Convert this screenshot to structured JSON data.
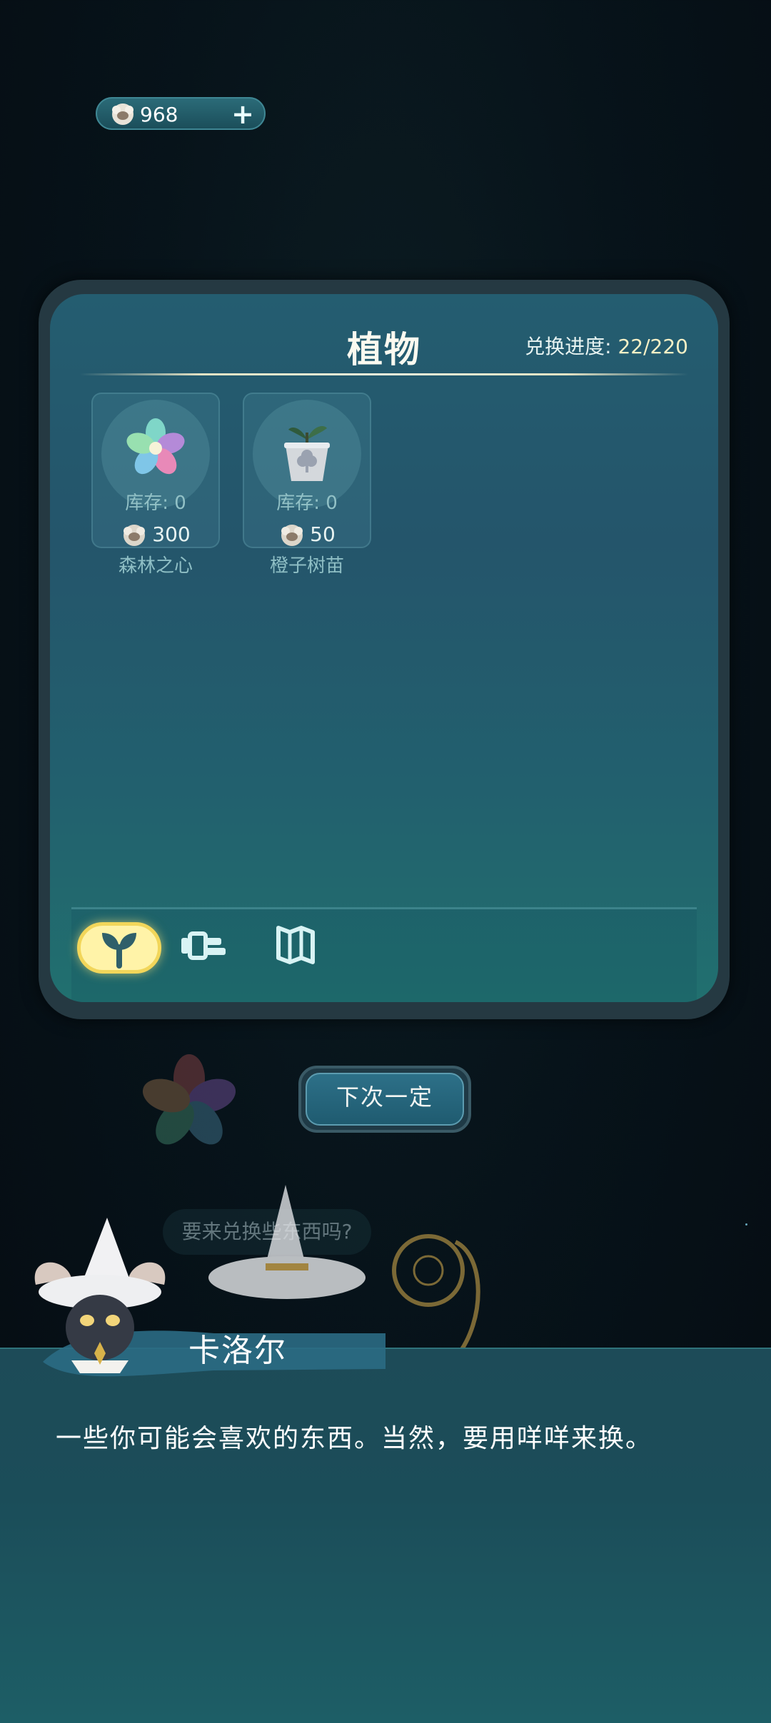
{
  "currency": {
    "amount": "968",
    "icon": "sheep-coin-icon",
    "add_label": "+"
  },
  "panel": {
    "title": "植物",
    "progress_label": "兑换进度:",
    "progress_value": "22/220",
    "items": [
      {
        "name": "森林之心",
        "stock": "库存: 0",
        "price": "300",
        "icon": "flower-icon"
      },
      {
        "name": "橙子树苗",
        "stock": "库存: 0",
        "price": "50",
        "icon": "sapling-pot-icon"
      }
    ],
    "tabs": [
      {
        "icon": "sprout-icon",
        "active": true
      },
      {
        "icon": "watering-can-icon",
        "active": false
      },
      {
        "icon": "map-icon",
        "active": false
      }
    ]
  },
  "next_button": "下次一定",
  "bubble_text": "要来兑换些东西吗?",
  "dialog": {
    "speaker": "卡洛尔",
    "text": "一些你可能会喜欢的东西。当然，要用咩咩来换。"
  },
  "colors": {
    "accent_tab": "#fff3a8",
    "panel": "#245d70",
    "dialog": "#1d4b58"
  }
}
